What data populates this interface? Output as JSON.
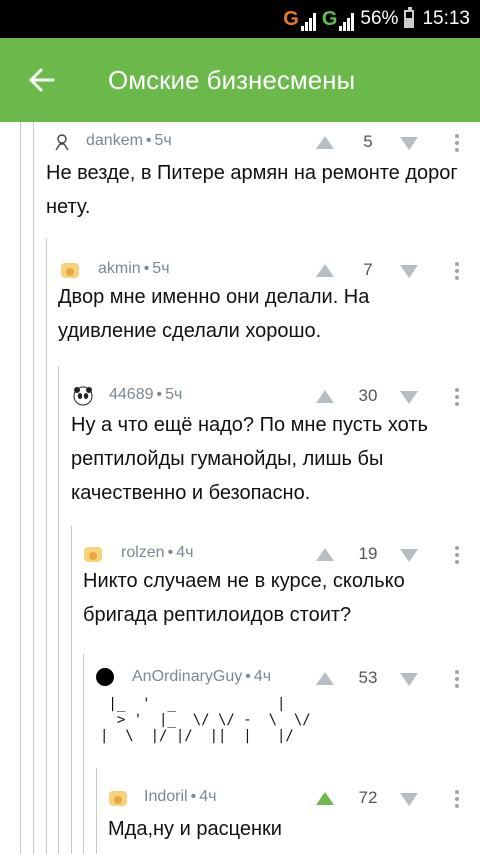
{
  "status_bar": {
    "sim1_label": "G",
    "sim2_label": "G",
    "battery_percent": "56%",
    "time": "15:13"
  },
  "app_bar": {
    "title": "Омские бизнесмены",
    "back_icon": "arrow-left-icon"
  },
  "comments": [
    {
      "author": "dankem",
      "time": "5ч",
      "rating": "5",
      "text": "Не везде, в Питере армян на ремонте дорог нету.",
      "avatar": "drawing-avatar"
    },
    {
      "author": "akmin",
      "time": "5ч",
      "rating": "7",
      "text": "Двор мне именно они делали. На удивление сделали хорошо.",
      "avatar": "default-avatar"
    },
    {
      "author": "44689",
      "time": "5ч",
      "rating": "30",
      "text": "Ну а что ещё надо? По мне пусть хоть рептилойды гуманойды, лишь бы качественно и безопасно.",
      "avatar": "panda-avatar"
    },
    {
      "author": "rolzen",
      "time": "4ч",
      "rating": "19",
      "text": "Никто случаем не в курсе, сколько бригада рептилоидов стоит?",
      "avatar": "default-avatar"
    },
    {
      "author": "AnOrdinaryGuy",
      "time": "4ч",
      "rating": "53",
      "ascii_line1": " |_  '  _            |",
      "ascii_line2": "  > '  |_  \\/ \\/ -  \\  \\/",
      "ascii_line3": "|  \\  |/ |/  ||  |   |/",
      "avatar": "black-circle-avatar"
    },
    {
      "author": "Indoril",
      "time": "4ч",
      "rating": "72",
      "text": "Мда,ну и расценки",
      "avatar": "default-avatar",
      "upvoted": true
    }
  ],
  "colors": {
    "accent": "#6bb84b",
    "status_bar": "#000000",
    "meta_text": "#7a8892",
    "vote_inactive": "#b6bec4"
  }
}
